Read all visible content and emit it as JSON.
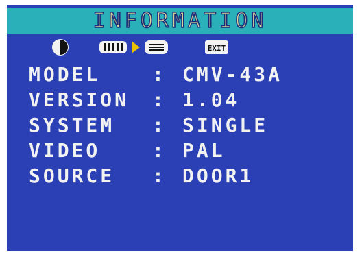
{
  "menu": {
    "title": "INFORMATION"
  },
  "icons": {
    "picture": "contrast-icon",
    "volume": "volume-bar-icon",
    "selector": "play-arrow-icon",
    "menu_list": "menu-list-icon",
    "exit": "exit-icon",
    "exit_label": "EXIT"
  },
  "info": {
    "rows": [
      {
        "label": "MODEL",
        "separator": ":",
        "value": "CMV-43A"
      },
      {
        "label": "VERSION",
        "separator": ":",
        "value": "1.04"
      },
      {
        "label": "SYSTEM",
        "separator": ":",
        "value": "SINGLE"
      },
      {
        "label": "VIDEO",
        "separator": ":",
        "value": "PAL"
      },
      {
        "label": "SOURCE",
        "separator": ":",
        "value": "DOOR1"
      }
    ]
  },
  "colors": {
    "background": "#2a40b4",
    "title_bar": "#2ab0b8",
    "title_text": "#d9d69a",
    "text": "#f2f2f2",
    "selector_arrow": "#e8c000"
  }
}
